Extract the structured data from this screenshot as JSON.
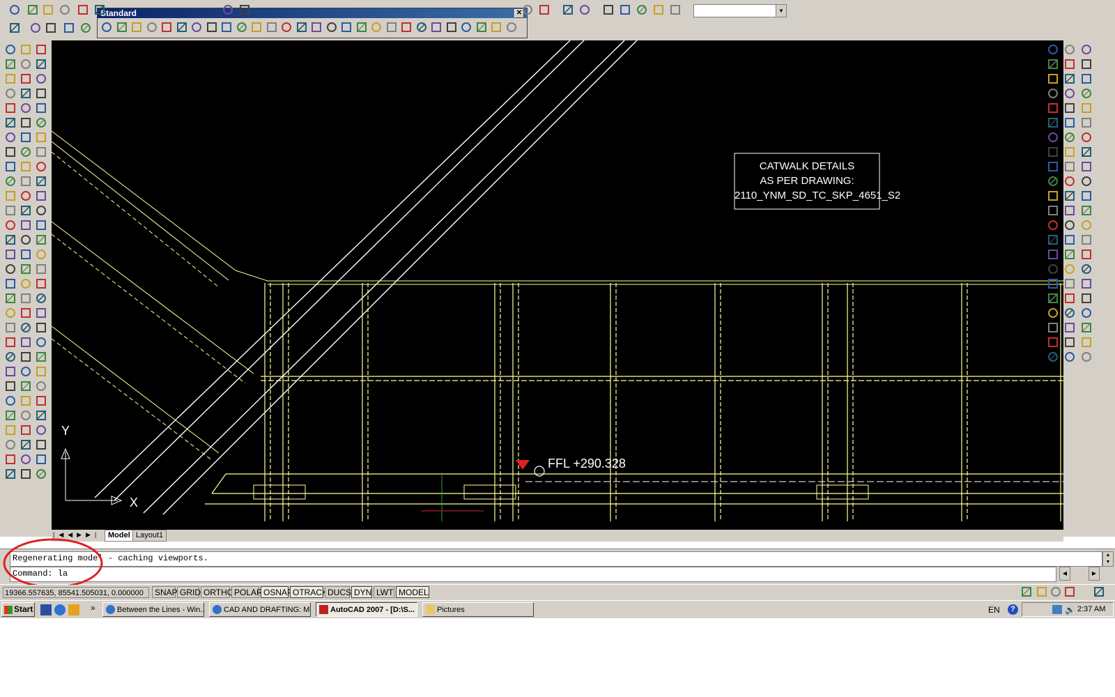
{
  "app": {
    "title": "AutoCAD 2007"
  },
  "toolbar_float": {
    "title": "Standard"
  },
  "layer_dropdown": {
    "value": ""
  },
  "drawing": {
    "note_lines": [
      "CATWALK DETAILS",
      "AS PER DRAWING:",
      "2110_YNM_SD_TC_SKP_4651_S2"
    ],
    "elevation_label": "FFL +290.328",
    "ucs_x": "X",
    "ucs_y": "Y"
  },
  "tabs": {
    "model": "Model",
    "layout1": "Layout1"
  },
  "command_line": {
    "history": "Regenerating model - caching viewports.",
    "prompt": "Command: la"
  },
  "status_bar": {
    "coordinates": "19366.557635, 85541.505031, 0.000000",
    "toggles": [
      "SNAP",
      "GRID",
      "ORTHO",
      "POLAR",
      "OSNAP",
      "OTRACK",
      "DUCS",
      "DYN",
      "LWT",
      "MODEL"
    ]
  },
  "taskbar": {
    "start": "Start",
    "items": [
      "Between the Lines - Win...",
      "CAD AND DRAFTING: Ma...",
      "AutoCAD 2007 - [D:\\S...",
      "Pictures"
    ],
    "language": "EN",
    "clock": "2:37 AM"
  },
  "colors": {
    "canvas": "#000000",
    "drawing_yellow": "#ffff99",
    "drawing_white": "#ffffff",
    "ui_gray": "#d4d0c8",
    "annotation_red": "#e02020",
    "title_blue": "#0a246a"
  },
  "icons": {
    "toolbar": "cad-tool-icon",
    "start": "windows-start-icon",
    "help": "help-icon"
  }
}
